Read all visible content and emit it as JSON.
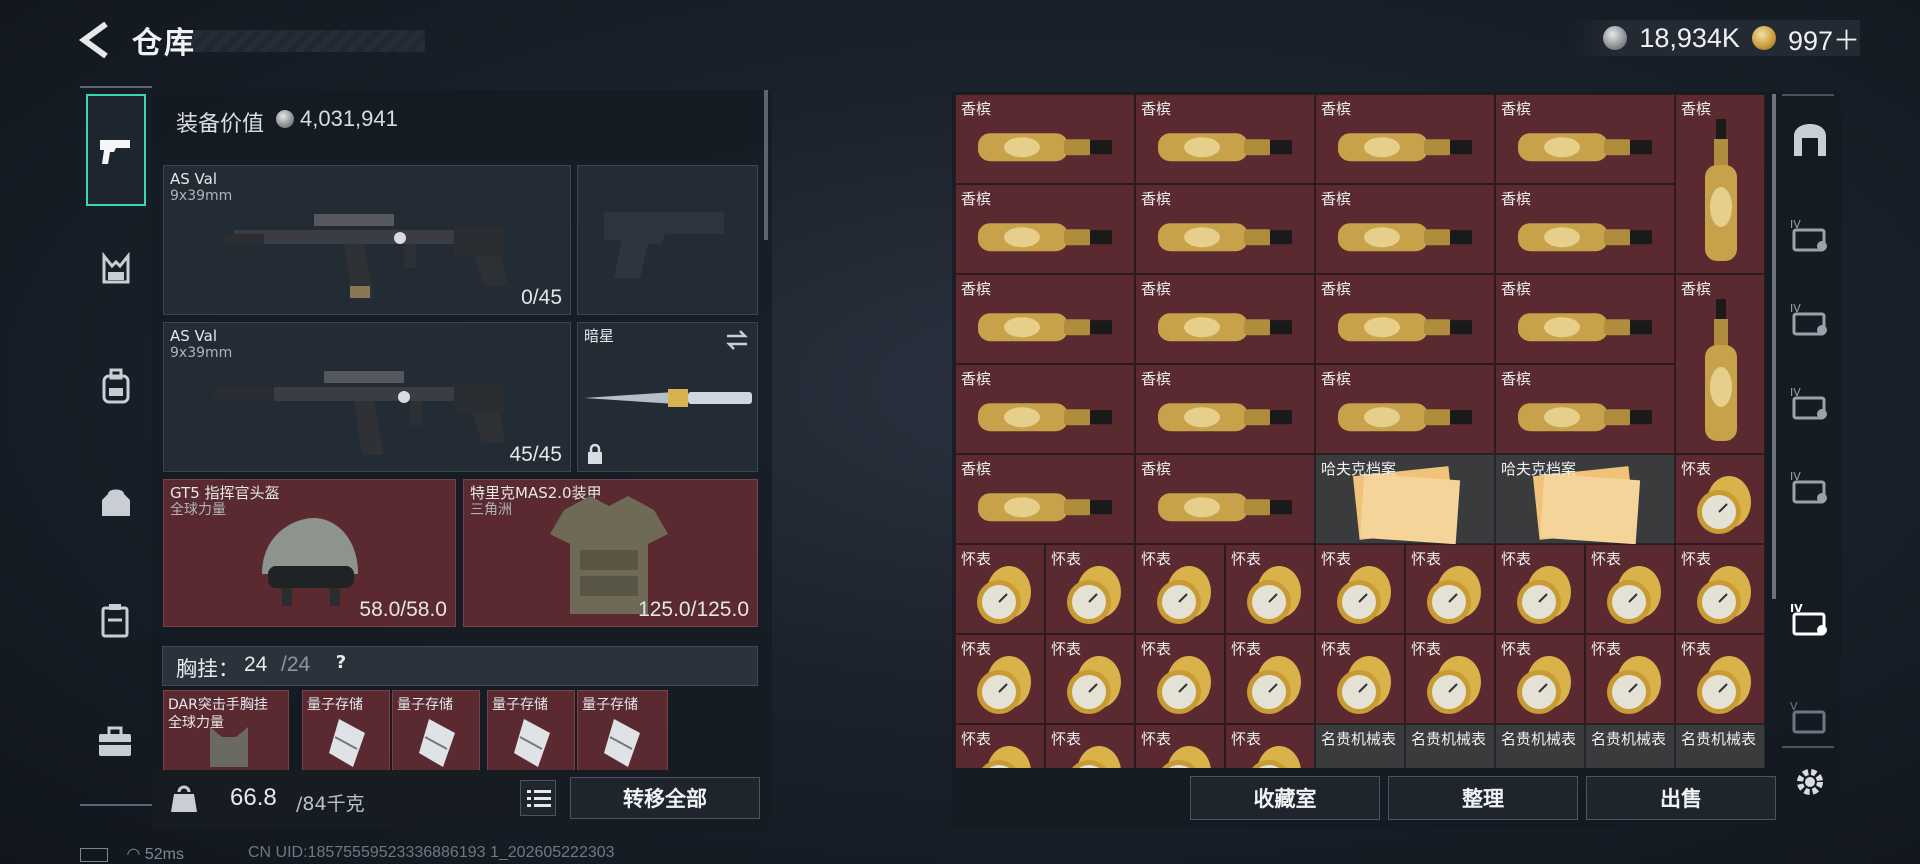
{
  "header": {
    "title": "仓库"
  },
  "currency": {
    "silver": "18,934K",
    "gold": "997＋"
  },
  "equipment": {
    "value_label": "装备价值",
    "value": "4,031,941",
    "weapon1": {
      "name": "AS Val",
      "caliber": "9x39mm",
      "ammo": "0/45"
    },
    "weapon2": {
      "name": "AS Val",
      "caliber": "9x39mm",
      "ammo": "45/45"
    },
    "melee": {
      "name": "暗星"
    },
    "helmet": {
      "name": "GT5 指挥官头盔",
      "sub": "全球力量",
      "durability": "58.0/58.0"
    },
    "armor": {
      "name": "特里克MAS2.0装甲",
      "sub": "三角洲",
      "durability": "125.0/125.0"
    },
    "vest": {
      "label": "胸挂：",
      "current": "24",
      "max": "/24",
      "help": "?"
    },
    "vest_item": {
      "name": "DAR突击手胸挂",
      "sub": "全球力量"
    },
    "storage_items": [
      "量子存储",
      "量子存储",
      "量子存储",
      "量子存储"
    ]
  },
  "weight": {
    "current": "66.8",
    "max": "/84千克"
  },
  "buttons": {
    "transfer_all": "转移全部",
    "collection": "收藏室",
    "organize": "整理",
    "sell": "出售"
  },
  "stash": {
    "champagne": "香槟",
    "file": "哈夫克档案",
    "watch": "怀表",
    "luxury_watch": "名贵机械表"
  },
  "status": {
    "ping": "52ms",
    "uid": "CN UID:18575559523336886193 1_202605222303"
  },
  "tabs": {
    "iv": "IV",
    "v": "V"
  }
}
